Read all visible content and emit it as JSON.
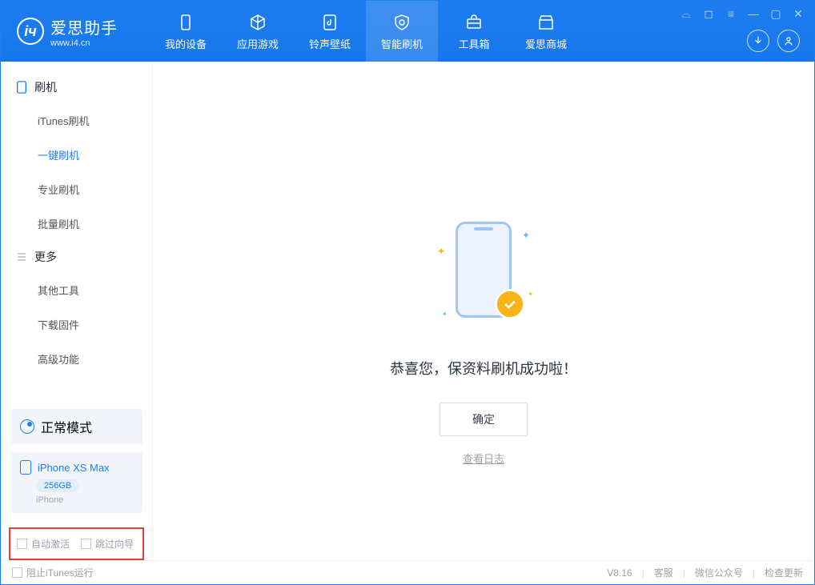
{
  "app": {
    "title": "爱思助手",
    "subtitle": "www.i4.cn"
  },
  "nav": [
    {
      "label": "我的设备"
    },
    {
      "label": "应用游戏"
    },
    {
      "label": "铃声壁纸"
    },
    {
      "label": "智能刷机"
    },
    {
      "label": "工具箱"
    },
    {
      "label": "爱思商城"
    }
  ],
  "sidebar": {
    "group1": {
      "title": "刷机",
      "items": [
        {
          "label": "iTunes刷机"
        },
        {
          "label": "一键刷机"
        },
        {
          "label": "专业刷机"
        },
        {
          "label": "批量刷机"
        }
      ]
    },
    "group2": {
      "title": "更多",
      "items": [
        {
          "label": "其他工具"
        },
        {
          "label": "下载固件"
        },
        {
          "label": "高级功能"
        }
      ]
    }
  },
  "device": {
    "mode_label": "正常模式",
    "name": "iPhone XS Max",
    "capacity": "256GB",
    "type": "iPhone"
  },
  "options": {
    "auto_activate": "自动激活",
    "skip_guide": "跳过向导"
  },
  "main": {
    "success_message": "恭喜您，保资料刷机成功啦！",
    "ok_button": "确定",
    "log_link": "查看日志"
  },
  "footer": {
    "block_itunes": "阻止iTunes运行",
    "version": "V8.16",
    "links": {
      "support": "客服",
      "wechat": "微信公众号",
      "update": "检查更新"
    }
  }
}
